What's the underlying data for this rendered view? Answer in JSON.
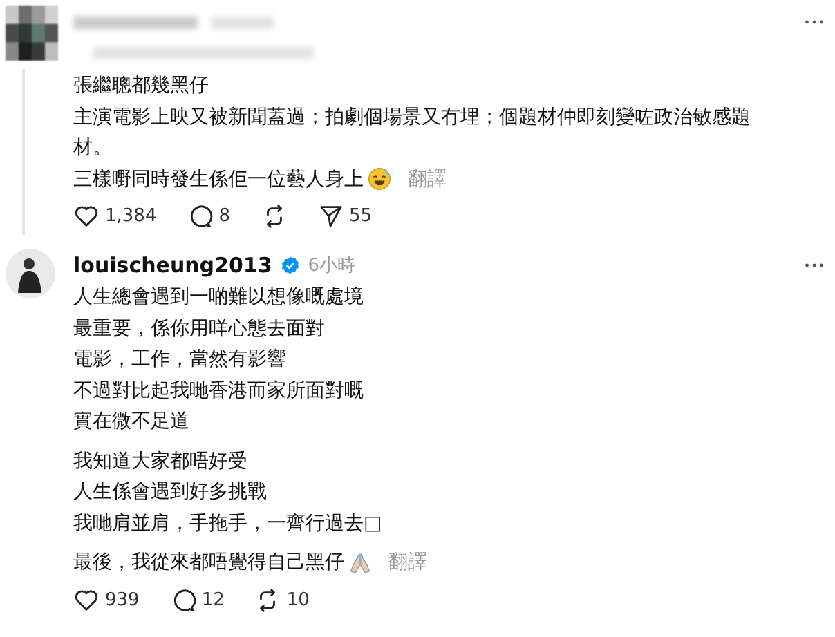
{
  "posts": [
    {
      "kind": "reply",
      "paragraphs": [
        [
          "張繼聰都幾黑仔",
          "主演電影上映又被新聞蓋過；拍劇個場景又冇埋；個題材仲即刻變咗政治敏感題材。",
          "三樣嘢同時發生係佢一位藝人身上"
        ]
      ],
      "emoji": {
        "kind": "sweat"
      },
      "translate": "翻譯",
      "likes": "1,384",
      "comments": "8",
      "shares": "55"
    },
    {
      "kind": "author",
      "author": "louischeung2013",
      "time": "6小時",
      "verified": true,
      "paragraphs": [
        [
          "人生總會遇到一啲難以想像嘅處境",
          "最重要，係你用咩心態去面對",
          "電影，工作，當然有影響",
          "不過對比起我哋香港而家所面對嘅",
          "實在微不足道"
        ],
        [
          "我知道大家都唔好受",
          "人生係會遇到好多挑戰",
          "我哋肩並肩，手拖手，一齊行過去□"
        ],
        [
          "最後，我從來都唔覺得自己黑仔"
        ]
      ],
      "emoji": {
        "kind": "pray"
      },
      "translate": "翻譯",
      "likes": "939",
      "comments": "12",
      "reposts": "10"
    }
  ]
}
